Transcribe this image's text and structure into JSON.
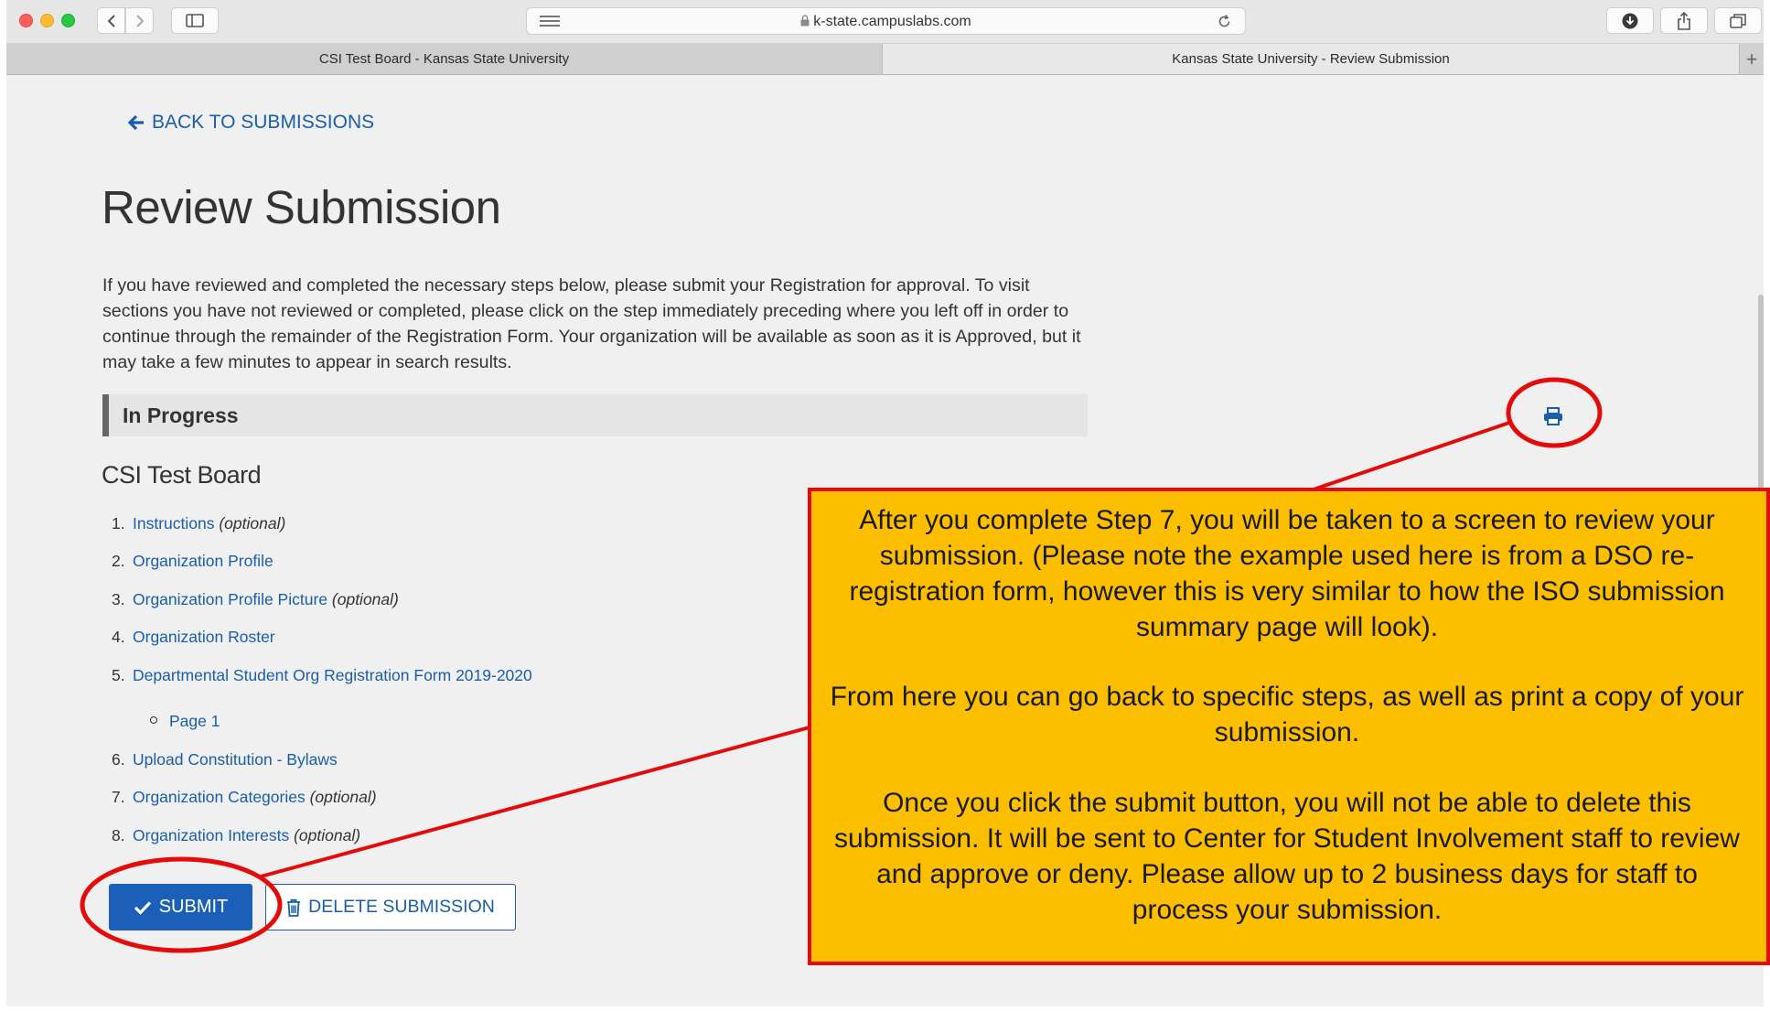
{
  "browser": {
    "address": "k-state.campuslabs.com",
    "tabs": [
      "CSI Test Board - Kansas State University",
      "Kansas State University - Review Submission"
    ],
    "new_tab_symbol": "+"
  },
  "page": {
    "back_link": "BACK TO SUBMISSIONS",
    "title": "Review Submission",
    "intro": "If you have reviewed and completed the necessary steps below, please submit your Registration for approval. To visit sections you have not reviewed or completed, please click on the step immediately preceding where you left off in order to continue through the remainder of the Registration Form. Your organization will be available as soon as it is Approved, but it may take a few minutes to appear in search results.",
    "status": "In Progress",
    "org_name": "CSI Test Board",
    "steps": [
      {
        "num": "1.",
        "label": "Instructions",
        "optional": "(optional)"
      },
      {
        "num": "2.",
        "label": "Organization Profile",
        "optional": ""
      },
      {
        "num": "3.",
        "label": "Organization Profile Picture",
        "optional": "(optional)"
      },
      {
        "num": "4.",
        "label": "Organization Roster",
        "optional": ""
      },
      {
        "num": "5.",
        "label": "Departmental Student Org Registration Form 2019-2020",
        "optional": ""
      },
      {
        "num": "6.",
        "label": "Upload Constitution - Bylaws",
        "optional": ""
      },
      {
        "num": "7.",
        "label": "Organization Categories",
        "optional": "(optional)"
      },
      {
        "num": "8.",
        "label": "Organization Interests",
        "optional": "(optional)"
      }
    ],
    "sub_step": "Page 1",
    "submit_label": "SUBMIT",
    "delete_label": "DELETE SUBMISSION"
  },
  "annotation": {
    "para1": "After you complete Step 7, you will be taken to a screen to review your submission. (Please note the example used here is from a DSO re-registration form, however this is very similar to how the ISO submission summary page will look).",
    "para2": "From here you can go back to specific steps, as well as print a copy of your submission.",
    "para3": "Once you click the submit button, you will not be able to delete this submission. It will be sent to Center for Student Involvement staff to review and approve or deny. Please allow up to 2 business days for staff to process your submission.",
    "colors": {
      "box": "#fbbf00",
      "outline": "#e60b0b"
    }
  },
  "colors": {
    "link": "#1a5dab",
    "primary_button": "#1b5fb8",
    "page_bg": "#f0f0f1"
  }
}
